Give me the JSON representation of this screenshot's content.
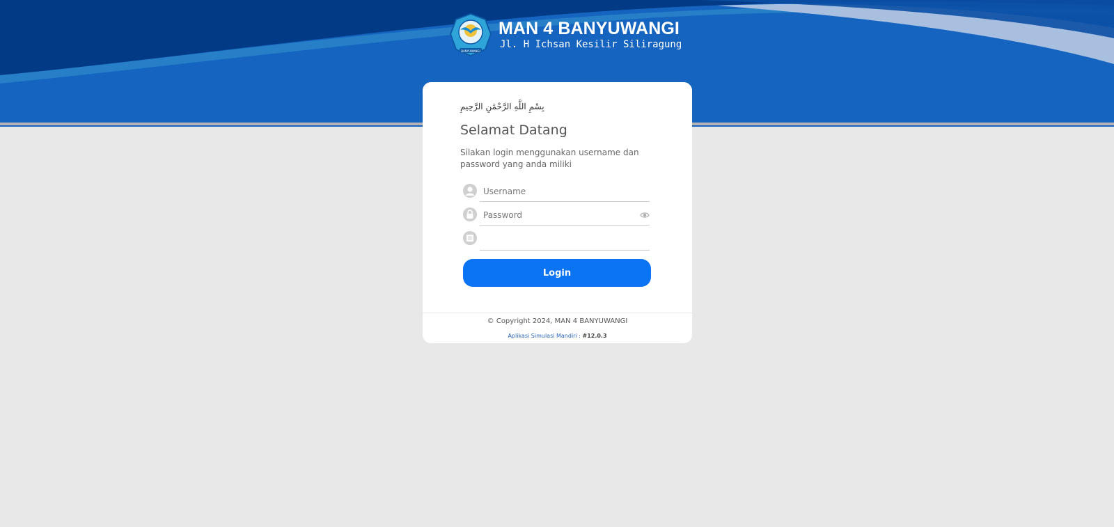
{
  "header": {
    "school_name": "MAN 4 BANYUWANGI",
    "address": "Jl. H Ichsan Kesilir Siliragung",
    "logo_text": "BANYUWANGI",
    "colors": {
      "dark_blue": "#033a86",
      "mid_blue": "#1565c0",
      "wave_light": "#a8bfe0"
    }
  },
  "login_card": {
    "bismillah": "بِسْمِ اللَّهِ الرَّحْمَٰنِ الرَّحِيمِ",
    "title": "Selamat Datang",
    "subtitle": "Silakan login menggunakan username dan password yang anda miliki",
    "username_placeholder": "Username",
    "password_placeholder": "Password",
    "third_field_value": "",
    "login_button": "Login",
    "button_color": "#0a74f5"
  },
  "footer": {
    "copyright": "© Copyright 2024, MAN 4 BANYUWANGI",
    "app_label": "Aplikasi Simulasi Mandiri :",
    "version": "#12.0.3"
  }
}
